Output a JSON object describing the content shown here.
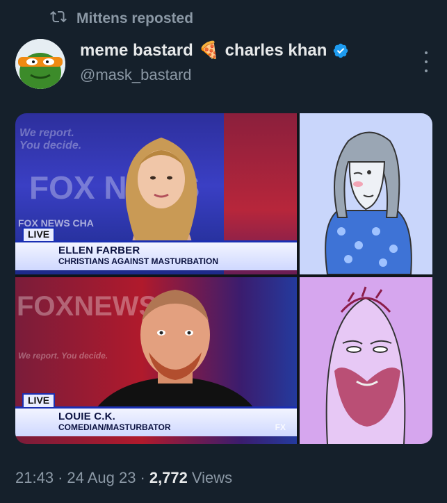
{
  "repost": {
    "text": "Mittens reposted"
  },
  "author": {
    "display_name": "meme bastard",
    "emoji": "🍕",
    "display_name_2": "charles khan",
    "handle": "@mask_bastard"
  },
  "media": {
    "top": {
      "live": "LIVE",
      "name": "ELLEN FARBER",
      "subtitle": "CHRISTIANS AGAINST MASTURBATION",
      "bg_text_1": "We report.",
      "bg_text_2": "You decide.",
      "bg_text_3": "FOX NEWS",
      "bg_text_4": "FOX NEWS CHA"
    },
    "bottom": {
      "live": "LIVE",
      "name": "LOUIE C.K.",
      "subtitle": "COMEDIAN/MASTURBATOR",
      "bg_text_1": "FOXNEWS",
      "bg_text_2": "We report. You decide."
    },
    "network_mark": "FX"
  },
  "meta": {
    "time": "21:43",
    "sep": "·",
    "date": "24 Aug 23",
    "views_count": "2,772",
    "views_label": "Views"
  },
  "colors": {
    "background": "#15202b",
    "secondary_text": "#8b98a5",
    "verified": "#1d9bf0"
  }
}
